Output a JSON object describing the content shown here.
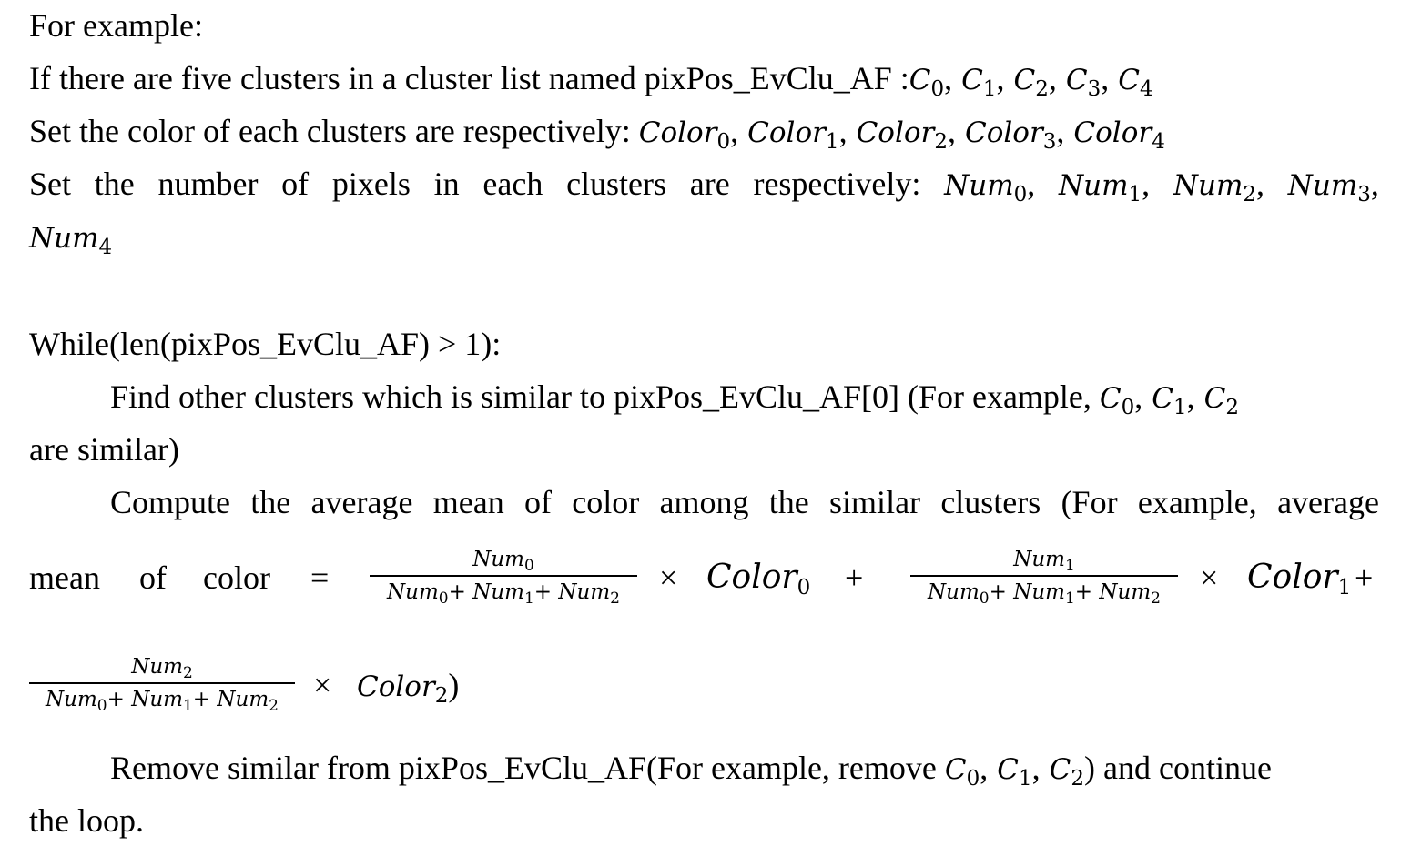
{
  "line1": "For example:",
  "line2_prefix": "If there are five clusters in a cluster list named pixPos_EvClu_AF :",
  "cluster_symbol": "C",
  "indices": [
    "0",
    "1",
    "2",
    "3",
    "4"
  ],
  "line3_prefix": "Set the color of each clusters are respectively: ",
  "color_symbol": "Color",
  "line4_words": [
    "Set",
    "the",
    "number",
    "of",
    "pixels",
    "in",
    "each",
    "clusters",
    "are",
    "respectively:"
  ],
  "num_symbol": "Num",
  "while_line": "While(len(pixPos_EvClu_AF) > 1):",
  "find_line_prefix": "Find other clusters which is similar to pixPos_EvClu_AF[0] (For example, ",
  "find_line_end": "are similar)",
  "compute_words": [
    "Compute",
    "the",
    "average",
    "mean",
    "of",
    "color",
    "among",
    "the",
    "similar",
    "clusters",
    "(For",
    "example,",
    "average"
  ],
  "mean_words": [
    "mean",
    "of",
    "color",
    "="
  ],
  "times": "×",
  "plus": "+",
  "close_paren": ")",
  "remove_prefix": "Remove similar from pixPos_EvClu_AF(For example, remove ",
  "remove_suffix": ") and continue",
  "final_line": "the loop."
}
